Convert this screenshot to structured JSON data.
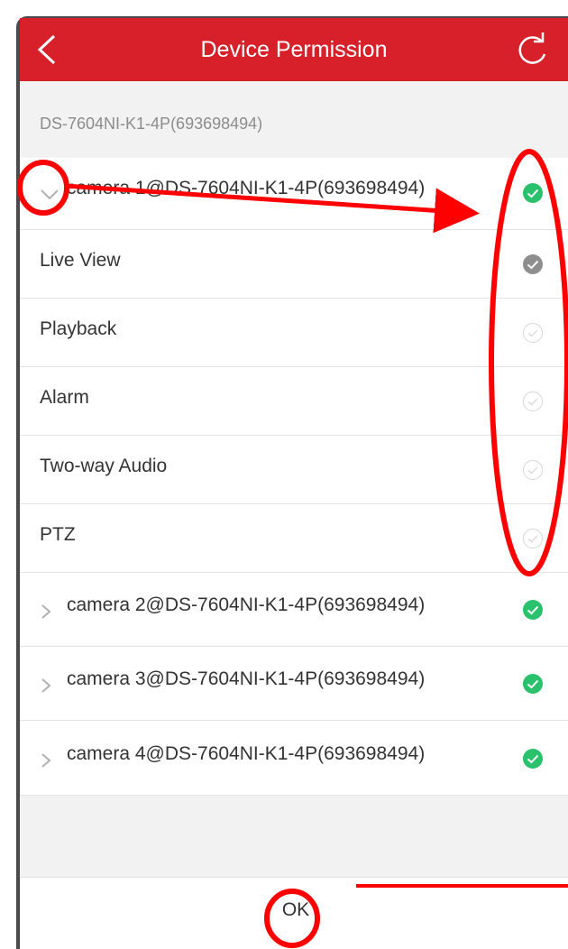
{
  "header": {
    "title": "Device Permission",
    "back_icon": "chevron-left-icon",
    "refresh_icon": "refresh-icon",
    "color": "#d8202a"
  },
  "device": {
    "group_label": "DS-7604NI-K1-4P(693698494)"
  },
  "expanded_camera": {
    "label": "camera 1@DS-7604NI-K1-4P(693698494)",
    "checked": true,
    "permissions": [
      {
        "label": "Live View",
        "state": "checked-gray"
      },
      {
        "label": "Playback",
        "state": "unchecked"
      },
      {
        "label": "Alarm",
        "state": "unchecked"
      },
      {
        "label": "Two-way Audio",
        "state": "unchecked"
      },
      {
        "label": "PTZ",
        "state": "unchecked"
      }
    ]
  },
  "cameras": [
    {
      "label": "camera 2@DS-7604NI-K1-4P(693698494)",
      "checked": true
    },
    {
      "label": "camera 3@DS-7604NI-K1-4P(693698494)",
      "checked": true
    },
    {
      "label": "camera 4@DS-7604NI-K1-4P(693698494)",
      "checked": true
    }
  ],
  "footer": {
    "ok_label": "OK"
  },
  "colors": {
    "check_green": "#2ac16c",
    "check_gray": "#8e8e8e",
    "annotation_red": "#ff0000"
  }
}
